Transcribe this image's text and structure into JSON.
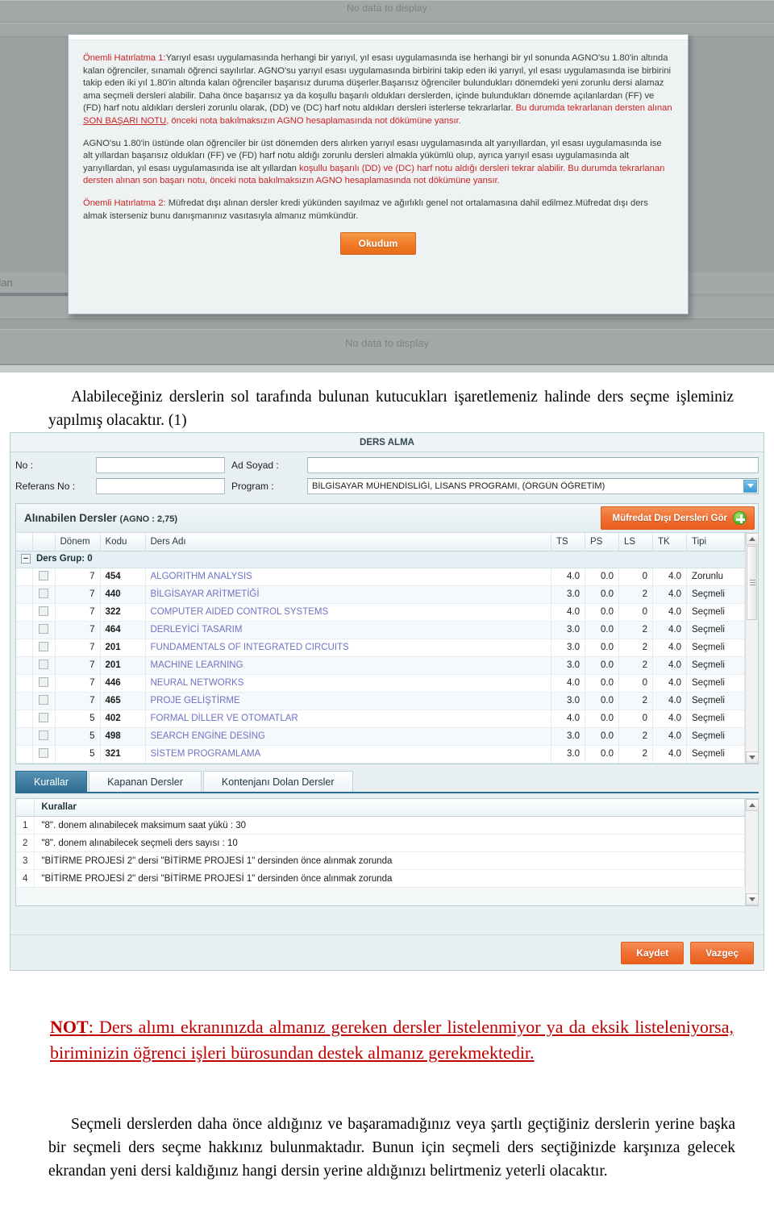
{
  "top_screenshot": {
    "no_data_top": "No data to display",
    "no_data_bottom": "No data to display",
    "ghost_tab": "njanı Dolan",
    "modal": {
      "para1_a": "Önemli Hatırlatma 1:",
      "para1_b": "Yarıyıl esası uygulamasında herhangi bir yarıyıl, yıl esası uygulamasında ise herhangi bir yıl sonunda AGNO'su 1.80'in altında kalan öğrenciler, sınamalı öğrenci sayılırlar. AGNO'su yarıyıl esası uygulamasında birbirini takip eden iki yarıyıl, yıl esası uygulamasında ise birbirini takip eden iki yıl 1.80'in altında kalan öğrenciler başarısız duruma düşerler.Başarısız öğrenciler bulundukları dönemdeki yeni zorunlu dersi alamaz ama seçmeli dersleri alabilir. Daha önce başarısız ya da koşullu başarılı oldukları derslerden, içinde bulundukları dönemde açılanlardan (FF) ve (FD) harf notu aldıkları dersleri zorunlu olarak, (DD) ve (DC) harf notu aldıkları dersleri isterlerse tekrarlarlar. ",
      "para1_c": "Bu durumda tekrarlanan dersten alınan ",
      "para1_d": "SON BAŞARI NOTU",
      "para1_e": ", önceki nota bakılmaksızın AGNO hesaplamasında not dökümüne yansır.",
      "para2_a": "AGNO'su 1.80'in üstünde olan öğrenciler bir üst dönemden ders alırken yarıyıl esası uygulamasında alt yarıyıllardan, yıl esası uygulamasında ise alt yıllardan başarısız oldukları (FF) ve (FD) harf notu aldığı zorunlu dersleri almakla yükümlü olup, ayrıca yarıyıl esası uygulamasında alt yarıyıllardan, yıl esası uygulamasında ise alt yıllardan ",
      "para2_b": "koşullu başarılı (DD) ve (DC) harf notu aldığı dersleri tekrar alabilir. Bu durumda tekrarlanan dersten alınan son başarı notu, önceki nota bakılmaksızın AGNO hesaplamasında not dökümüne yansır.",
      "para3_a": "Önemli Hatırlatma 2:",
      "para3_b": " Müfredat dışı alınan dersler kredi yükünden sayılmaz ve ağırlıklı genel not ortalamasına dahil edilmez.Müfredat dışı ders almak isterseniz bunu danışmanınız vasıtasıyla almanız mümkündür.",
      "okudum_label": "Okudum"
    }
  },
  "caption_first": "Alabileceğiniz derslerin sol tarafında bulunan kutucukları işaretlemeniz halinde ders seçme işleminiz yapılmış olacaktır. (1)",
  "ders_alma": {
    "title": "DERS ALMA",
    "fields": {
      "no_label": "No :",
      "no_value": "",
      "ad_soyad_label": "Ad Soyad :",
      "ad_soyad_value": "",
      "referans_label": "Referans No :",
      "referans_value": "",
      "program_label": "Program :",
      "program_value": "BİLGİSAYAR MÜHENDİSLİĞİ, LİSANS PROGRAMI, (ÖRGÜN ÖĞRETİM)"
    },
    "grid": {
      "header_title": "Alınabilen Dersler ",
      "header_agno": "(AGNO : 2,75)",
      "mufredat_button": "Müfredat Dışı Dersleri Gör",
      "columns": [
        "",
        "",
        "Dönem",
        "Kodu",
        "Ders Adı",
        "TS",
        "PS",
        "LS",
        "TK",
        "Tipi"
      ],
      "group_label": "Ders Grup: 0",
      "rows": [
        {
          "donem": "7",
          "kodu": "454",
          "ad": "ALGORITHM ANALYSIS",
          "ts": "4.0",
          "ps": "0.0",
          "ls": "0",
          "tk": "4.0",
          "tipi": "Zorunlu"
        },
        {
          "donem": "7",
          "kodu": "440",
          "ad": "BİLGİSAYAR ARİTMETİĞİ",
          "ts": "3.0",
          "ps": "0.0",
          "ls": "2",
          "tk": "4.0",
          "tipi": "Seçmeli"
        },
        {
          "donem": "7",
          "kodu": "322",
          "ad": "COMPUTER AIDED CONTROL SYSTEMS",
          "ts": "4.0",
          "ps": "0.0",
          "ls": "0",
          "tk": "4.0",
          "tipi": "Seçmeli"
        },
        {
          "donem": "7",
          "kodu": "464",
          "ad": "DERLEYİCİ TASARIM",
          "ts": "3.0",
          "ps": "0.0",
          "ls": "2",
          "tk": "4.0",
          "tipi": "Seçmeli"
        },
        {
          "donem": "7",
          "kodu": "201",
          "ad": "FUNDAMENTALS OF INTEGRATED CIRCUITS",
          "ts": "3.0",
          "ps": "0.0",
          "ls": "2",
          "tk": "4.0",
          "tipi": "Seçmeli"
        },
        {
          "donem": "7",
          "kodu": "201",
          "ad": "MACHINE LEARNING",
          "ts": "3.0",
          "ps": "0.0",
          "ls": "2",
          "tk": "4.0",
          "tipi": "Seçmeli"
        },
        {
          "donem": "7",
          "kodu": "446",
          "ad": "NEURAL NETWORKS",
          "ts": "4.0",
          "ps": "0.0",
          "ls": "0",
          "tk": "4.0",
          "tipi": "Seçmeli"
        },
        {
          "donem": "7",
          "kodu": "465",
          "ad": "PROJE GELİŞTİRME",
          "ts": "3.0",
          "ps": "0.0",
          "ls": "2",
          "tk": "4.0",
          "tipi": "Seçmeli"
        },
        {
          "donem": "5",
          "kodu": "402",
          "ad": "FORMAL DİLLER VE OTOMATLAR",
          "ts": "4.0",
          "ps": "0.0",
          "ls": "0",
          "tk": "4.0",
          "tipi": "Seçmeli"
        },
        {
          "donem": "5",
          "kodu": "498",
          "ad": "SEARCH ENGİNE DESİNG",
          "ts": "3.0",
          "ps": "0.0",
          "ls": "2",
          "tk": "4.0",
          "tipi": "Seçmeli"
        },
        {
          "donem": "5",
          "kodu": "321",
          "ad": "SİSTEM PROGRAMLAMA",
          "ts": "3.0",
          "ps": "0.0",
          "ls": "2",
          "tk": "4.0",
          "tipi": "Seçmeli"
        }
      ]
    },
    "tabs": [
      {
        "label": "Kurallar",
        "active": true
      },
      {
        "label": "Kapanan Dersler",
        "active": false
      },
      {
        "label": "Kontenjanı Dolan Dersler",
        "active": false
      }
    ],
    "rules": {
      "column_header": "Kurallar",
      "items": [
        {
          "no": "1",
          "text": "\"8\". donem alınabilecek maksimum saat yükü : 30"
        },
        {
          "no": "2",
          "text": "\"8\". donem alınabilecek seçmeli ders sayısı : 10"
        },
        {
          "no": "3",
          "text": "\"BİTİRME PROJESİ 2\" dersi \"BİTİRME PROJESİ 1\" dersinden önce alınmak zorunda"
        },
        {
          "no": "4",
          "text": "\"BİTİRME PROJESİ 2\" dersi \"BİTİRME PROJESİ 1\" dersinden önce alınmak zorunda"
        }
      ]
    },
    "footer": {
      "save_label": "Kaydet",
      "cancel_label": "Vazgeç"
    }
  },
  "note_red": {
    "bold": "NOT",
    "rest": ": Ders alımı ekranınızda almanız gereken dersler listelenmiyor ya da eksik listeleniyorsa, biriminizin öğrenci işleri bürosundan destek almanız gerekmektedir."
  },
  "caption_last": "Seçmeli derslerden daha önce aldığınız ve başaramadığınız veya şartlı geçtiğiniz derslerin yerine başka bir seçmeli ders seçme hakkınız bulunmaktadır. Bunun için seçmeli ders seçtiğinizde karşınıza gelecek ekrandan yeni dersi kaldığınız hangi dersin yerine aldığınızı belirtmeniz yeterli olacaktır.",
  "colors": {
    "orange": "#ef7034",
    "tab_active": "#2f6d92",
    "note_red": "#c00000",
    "warn_red": "#cc2222",
    "link_purple": "#6f71c4"
  }
}
